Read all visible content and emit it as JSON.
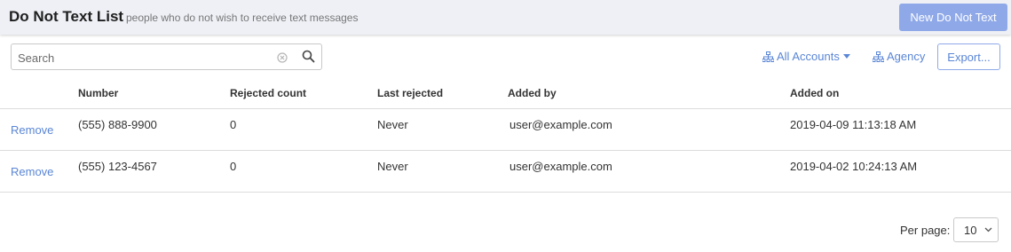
{
  "header": {
    "title": "Do Not Text List",
    "subtitle": "people who do not wish to receive text messages",
    "new_button": "New Do Not Text"
  },
  "toolbar": {
    "search_placeholder": "Search",
    "search_value": "",
    "accounts_label": "All Accounts",
    "agency_label": "Agency",
    "export_label": "Export..."
  },
  "table": {
    "columns": [
      "Number",
      "Rejected count",
      "Last rejected",
      "Added by",
      "Added on"
    ],
    "rows": [
      {
        "action": "Remove",
        "number": "(555) 888-9900",
        "rejected_count": "0",
        "last_rejected": "Never",
        "added_by": "user@example.com",
        "added_on": "2019-04-09 11:13:18 AM"
      },
      {
        "action": "Remove",
        "number": "(555) 123-4567",
        "rejected_count": "0",
        "last_rejected": "Never",
        "added_by": "user@example.com",
        "added_on": "2019-04-02 10:24:13 AM"
      }
    ]
  },
  "pagination": {
    "per_page_label": "Per page:",
    "per_page_value": "10"
  },
  "colors": {
    "accent": "#5a86d6",
    "primary_button": "#8fa9e8",
    "header_bg": "#eef0f5"
  },
  "icons": [
    "clear-icon",
    "search-icon",
    "hierarchy-icon",
    "caret-down-icon",
    "chevron-down-icon"
  ]
}
